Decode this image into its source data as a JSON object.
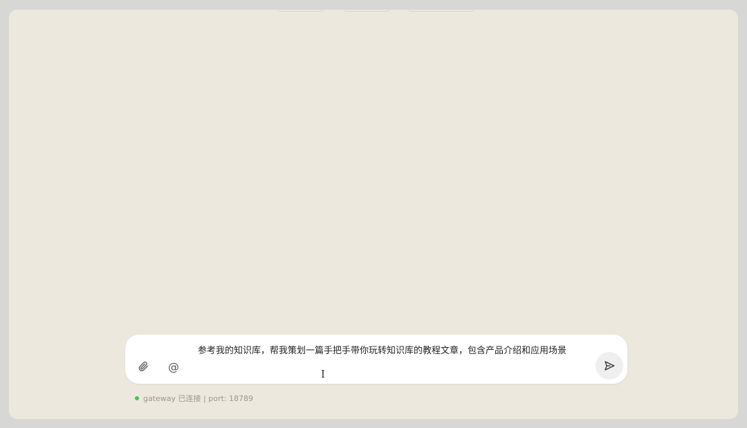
{
  "composer": {
    "text": "参考我的知识库，帮我策划一篇手把手带你玩转知识库的教程文章，包含产品介绍和应用场景",
    "attach_icon": "paperclip-icon",
    "mention_icon": "at-icon",
    "mention_glyph": "@",
    "send_icon": "send-icon"
  },
  "status": {
    "connection": "gateway 已连接 | port: 18789",
    "dot_color": "#4cc05a"
  },
  "colors": {
    "background": "#ece8de",
    "card": "#ffffff"
  }
}
